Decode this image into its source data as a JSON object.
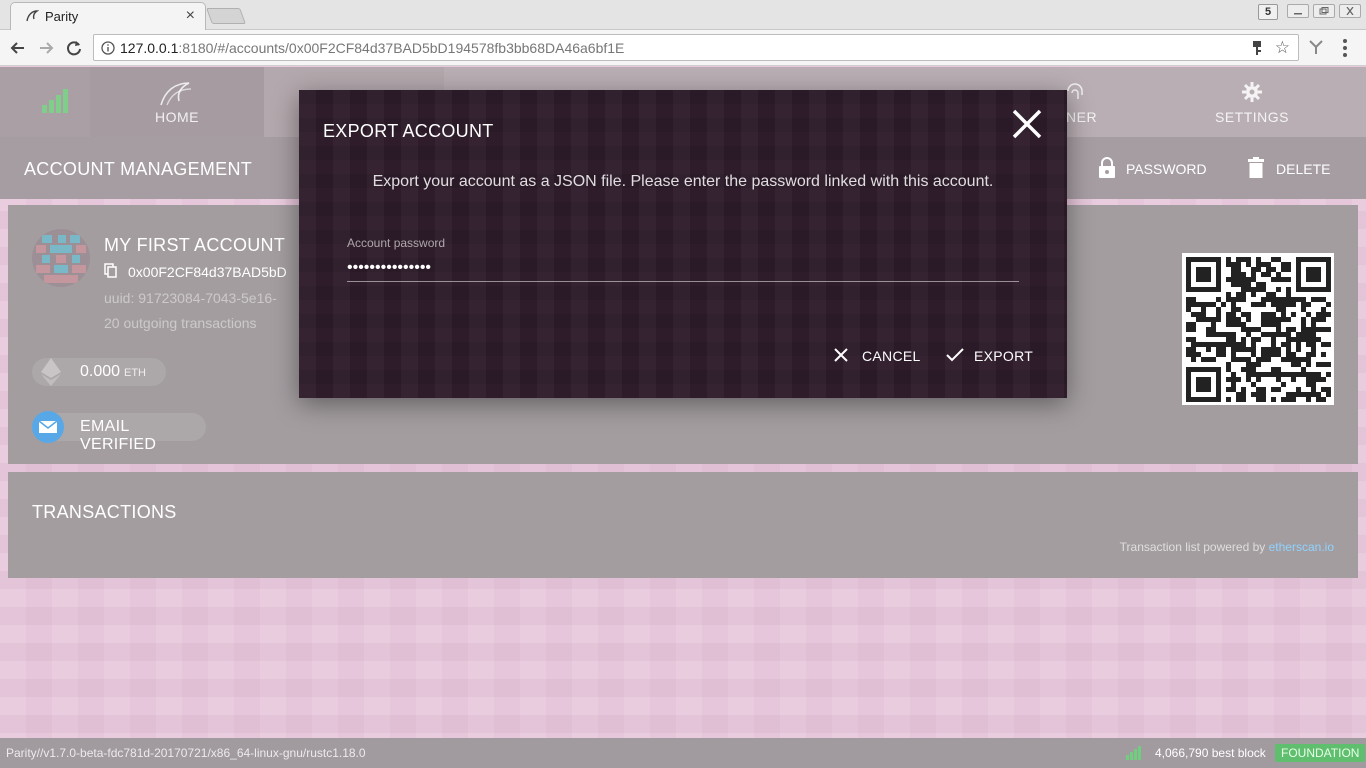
{
  "browser": {
    "tab_title": "Parity",
    "tab_close": "×",
    "extension_badge": "5",
    "url_host": "127.0.0.1",
    "url_rest": ":8180/#/accounts/0x00F2CF84d37BAD5bD194578fb3bb68DA46a6bf1E"
  },
  "nav": {
    "home_label": "HOME",
    "signer_label_partial": "NER",
    "settings_label": "SETTINGS"
  },
  "action_bar": {
    "title": "ACCOUNT MANAGEMENT",
    "password_label": "PASSWORD",
    "delete_label": "DELETE"
  },
  "account": {
    "name": "MY FIRST ACCOUNT",
    "address": "0x00F2CF84d37BAD5bD",
    "uuid": "uuid: 91723084-7043-5e16-",
    "tx_count": "20 outgoing transactions",
    "balance_value": "0.000",
    "balance_unit": "ETH",
    "email_badge": "EMAIL VERIFIED"
  },
  "transactions": {
    "title": "TRANSACTIONS",
    "powered_prefix": "Transaction list powered by ",
    "powered_link": "etherscan.io"
  },
  "modal": {
    "title": "EXPORT ACCOUNT",
    "description": "Export your account as a JSON file. Please enter the password linked with this account.",
    "password_label": "Account password",
    "password_value": "•••••••••••••••",
    "cancel_label": "CANCEL",
    "export_label": "EXPORT"
  },
  "footer": {
    "version": "Parity//v1.7.0-beta-fdc781d-20170721/x86_64-linux-gnu/rustc1.18.0",
    "best_block": "4,066,790 best block",
    "chain": "FOUNDATION"
  },
  "colors": {
    "accent_green": "#5fbf6e",
    "modal_bg": "#2f1c2b",
    "link_blue": "#8fd3ff"
  }
}
